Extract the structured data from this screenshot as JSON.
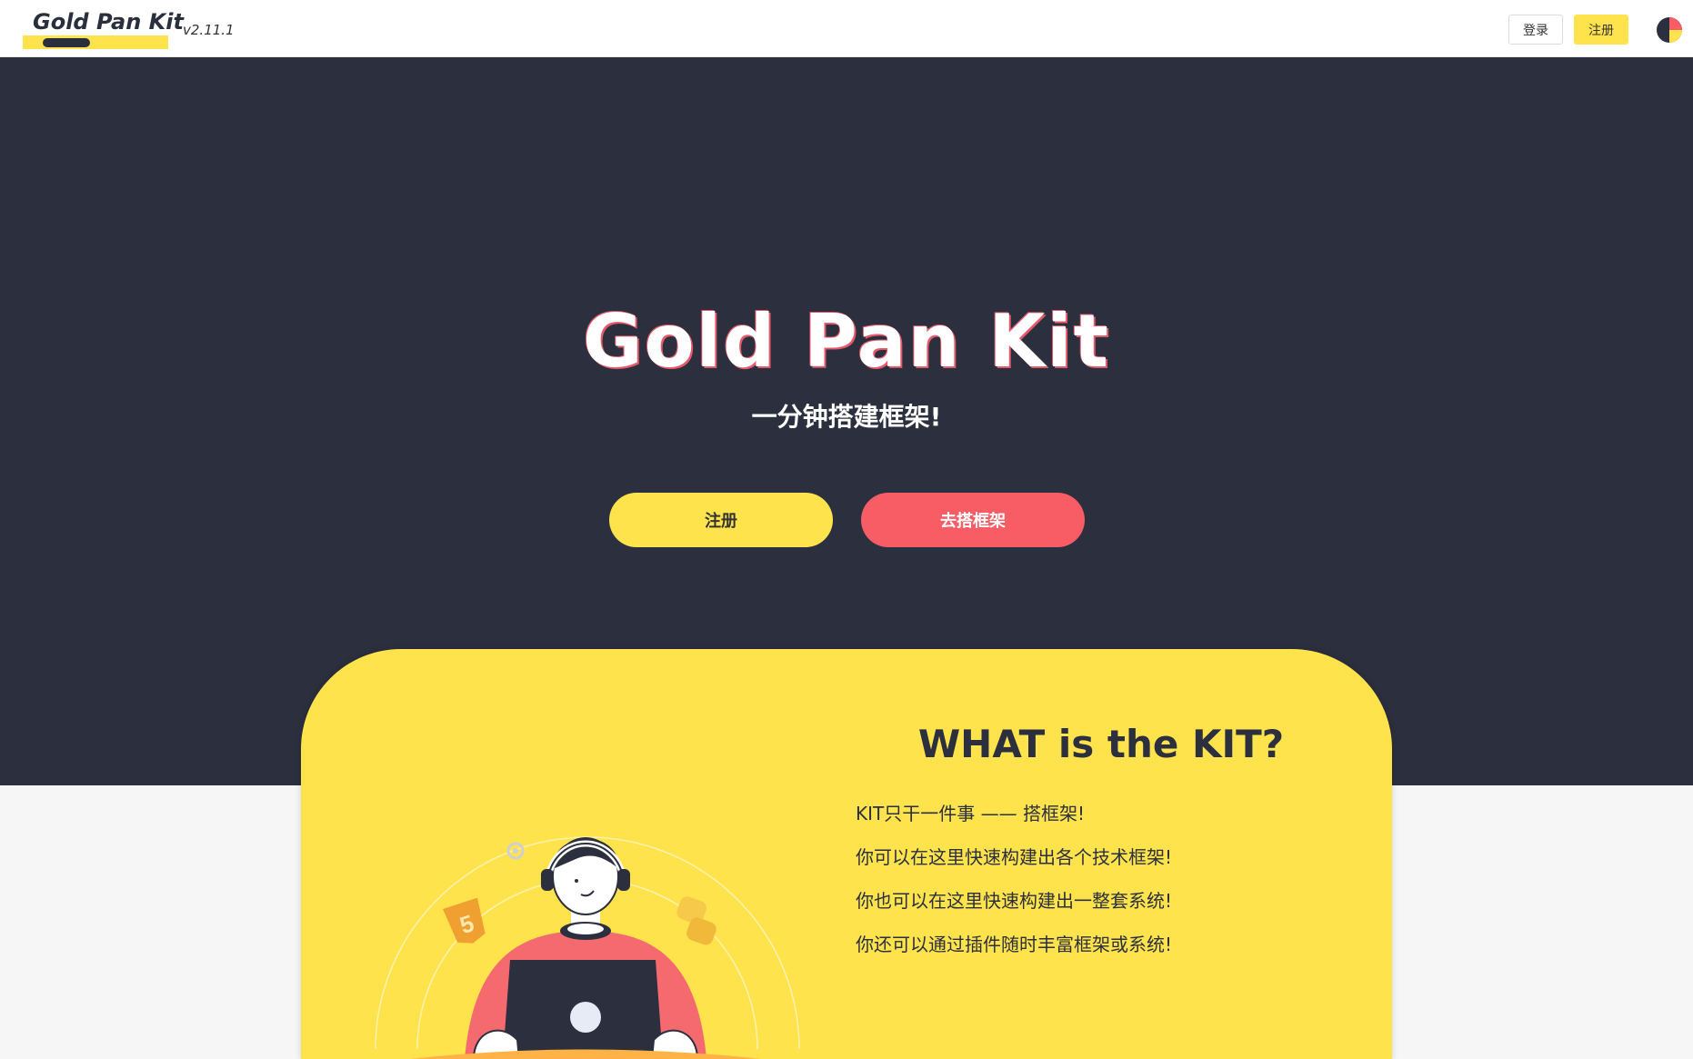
{
  "header": {
    "logo_text": "Gold Pan Kit",
    "version": "v2.11.1",
    "login_label": "登录",
    "register_label": "注册",
    "theme_icon": "theme-palette-icon"
  },
  "hero": {
    "title": "Gold Pan Kit",
    "subtitle": "一分钟搭建框架!",
    "register_button": "注册",
    "build_button": "去搭框架"
  },
  "intro": {
    "title": "WHAT is the KIT?",
    "lines": [
      "KIT只干一件事 —— 搭框架!",
      "你可以在这里快速构建出各个技术框架!",
      "你也可以在这里快速构建出一整套系统!",
      "你还可以通过插件随时丰富框架或系统!"
    ]
  },
  "colors": {
    "accent_yellow": "#ffe34d",
    "accent_red": "#f85d66",
    "hero_bg": "#2b2f3e"
  }
}
